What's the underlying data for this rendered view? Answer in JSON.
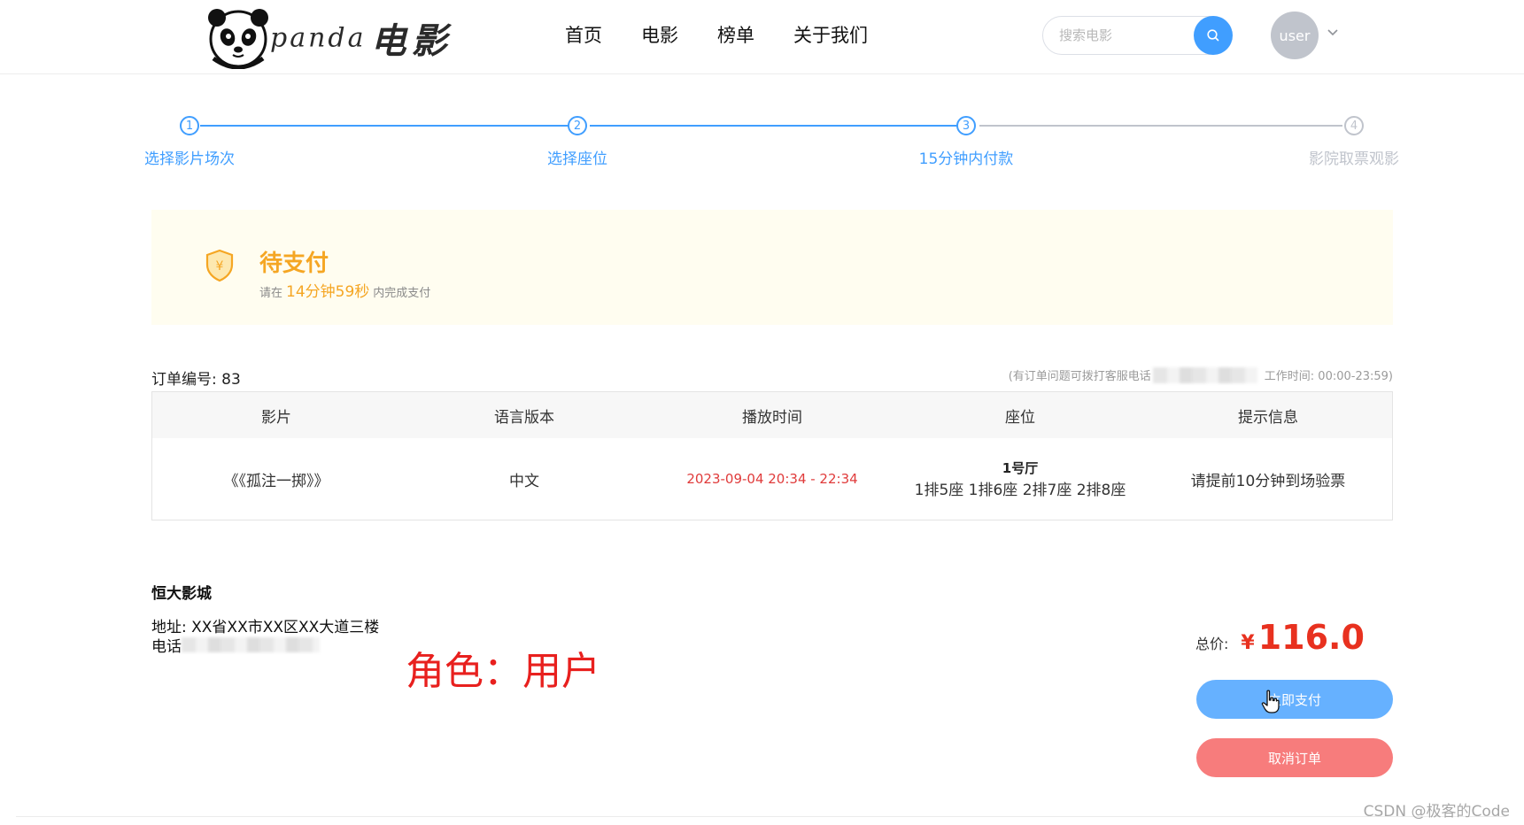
{
  "header": {
    "logo_en": "panda",
    "logo_cn": "电影",
    "nav": [
      "首页",
      "电影",
      "榜单",
      "关于我们"
    ],
    "search_placeholder": "搜索电影",
    "avatar_text": "user"
  },
  "steps": [
    {
      "num": "1",
      "label": "选择影片场次",
      "active": true
    },
    {
      "num": "2",
      "label": "选择座位",
      "active": true
    },
    {
      "num": "3",
      "label": "15分钟内付款",
      "active": true
    },
    {
      "num": "4",
      "label": "影院取票观影",
      "active": false
    }
  ],
  "pay_status": {
    "title": "待支付",
    "prefix": "请在",
    "countdown": "14分钟59秒",
    "suffix": "内完成支付"
  },
  "order": {
    "number_label": "订单编号: 83",
    "help_text": "(有订单问题可拨打客服电话",
    "work_hours": "工作时间: 00:00-23:59)",
    "columns": [
      "影片",
      "语言版本",
      "播放时间",
      "座位",
      "提示信息"
    ],
    "row": {
      "movie": "《《孤注一掷》》",
      "language": "中文",
      "time": "2023-09-04 20:34 - 22:34",
      "hall": "1号厅",
      "seats": "1排5座 1排6座 2排7座 2排8座",
      "tip": "请提前10分钟到场验票"
    }
  },
  "cinema": {
    "name": "恒大影城",
    "address": "地址: XX省XX市XX区XX大道三楼",
    "phone_label": "电话"
  },
  "annotation": "角色：用户",
  "total": {
    "label": "总价:",
    "currency": "¥",
    "amount": "116.0"
  },
  "buttons": {
    "pay": "立即支付",
    "cancel": "取消订单"
  },
  "watermark": "CSDN @极客的Code",
  "colors": {
    "primary": "#409eff",
    "warning": "#f5a623",
    "danger": "#e8311f",
    "cancel_button": "#f77c7c"
  }
}
